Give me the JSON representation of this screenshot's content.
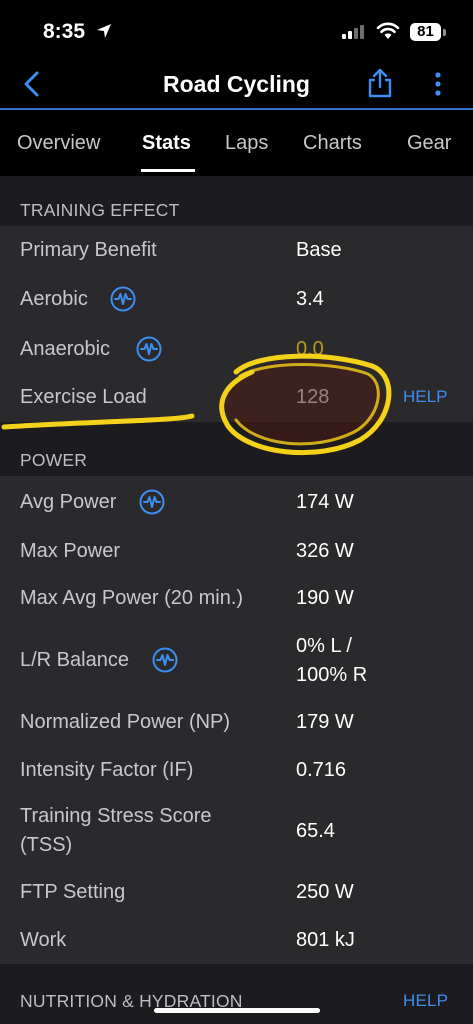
{
  "status": {
    "time": "8:35",
    "battery": "81"
  },
  "nav": {
    "title": "Road Cycling"
  },
  "tabs": [
    {
      "label": "Overview"
    },
    {
      "label": "Stats"
    },
    {
      "label": "Laps"
    },
    {
      "label": "Charts"
    },
    {
      "label": "Gear"
    }
  ],
  "sections": {
    "training_effect": {
      "title": "TRAINING EFFECT",
      "help": "HELP",
      "rows": [
        {
          "label": "Primary Benefit",
          "value": "Base"
        },
        {
          "label": "Aerobic",
          "value": "3.4"
        },
        {
          "label": "Anaerobic",
          "value": "0.0"
        },
        {
          "label": "Exercise Load",
          "value": "128"
        }
      ]
    },
    "power": {
      "title": "POWER",
      "rows": [
        {
          "label": "Avg Power",
          "value": "174 W"
        },
        {
          "label": "Max Power",
          "value": "326 W"
        },
        {
          "label": "Max Avg Power (20 min.)",
          "value": "190 W"
        },
        {
          "label": "L/R Balance",
          "value_line1": "0% L /",
          "value_line2": "100% R"
        },
        {
          "label": "Normalized Power (NP)",
          "value": "179 W"
        },
        {
          "label": "Intensity Factor (IF)",
          "value": "0.716"
        },
        {
          "label_line1": "Training Stress Score",
          "label_line2": "(TSS)",
          "value": "65.4"
        },
        {
          "label": "FTP Setting",
          "value": "250 W"
        },
        {
          "label": "Work",
          "value": "801 kJ"
        }
      ]
    },
    "nutrition": {
      "title": "NUTRITION & HYDRATION",
      "help": "HELP"
    }
  },
  "colors": {
    "accent": "#3d8ef0",
    "annotation": "#f5d21a",
    "background": "#1c1c1e",
    "row_background": "#2a2a2c"
  }
}
